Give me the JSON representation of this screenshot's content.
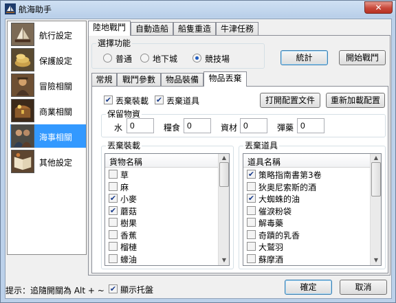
{
  "window": {
    "title": "航海助手",
    "close_label": "✕"
  },
  "sidebar": {
    "items": [
      {
        "label": "航行設定",
        "icon": "ship-icon",
        "selected": false
      },
      {
        "label": "保護設定",
        "icon": "coins-icon",
        "selected": false
      },
      {
        "label": "冒險相關",
        "icon": "explorer-icon",
        "selected": false
      },
      {
        "label": "商業相關",
        "icon": "treasure-chest-icon",
        "selected": false
      },
      {
        "label": "海事相關",
        "icon": "sailors-icon",
        "selected": true
      },
      {
        "label": "其他設定",
        "icon": "book-icon",
        "selected": false
      }
    ]
  },
  "main_tabs": [
    {
      "label": "陸地戰鬥",
      "active": true
    },
    {
      "label": "自動造船",
      "active": false
    },
    {
      "label": "船隻重造",
      "active": false
    },
    {
      "label": "牛津任務",
      "active": false
    }
  ],
  "function_group": {
    "title": "選擇功能",
    "options": [
      {
        "label": "普通",
        "selected": false
      },
      {
        "label": "地下城",
        "selected": false
      },
      {
        "label": "競技場",
        "selected": true
      }
    ]
  },
  "buttons": {
    "stats": "統計",
    "start_battle": "開始戰鬥",
    "open_config": "打開配置文件",
    "reload_config": "重新加載配置",
    "ok": "確定",
    "cancel": "取消"
  },
  "sub_tabs": [
    {
      "label": "常規",
      "active": false
    },
    {
      "label": "戰鬥參數",
      "active": false
    },
    {
      "label": "物品裝備",
      "active": false
    },
    {
      "label": "物品丟棄",
      "active": true
    }
  ],
  "discard": {
    "discard_equipment": {
      "label": "丟棄裝載",
      "checked": true
    },
    "discard_items": {
      "label": "丟棄道具",
      "checked": true
    }
  },
  "reserve": {
    "title": "保留物資",
    "fields": [
      {
        "label": "水",
        "value": "0"
      },
      {
        "label": "糧食",
        "value": "0"
      },
      {
        "label": "資材",
        "value": "0"
      },
      {
        "label": "彈藥",
        "value": "0"
      }
    ]
  },
  "equip_list": {
    "title": "丟棄裝載",
    "header": "貨物名稱",
    "rows": [
      {
        "label": "草",
        "checked": false
      },
      {
        "label": "麻",
        "checked": false
      },
      {
        "label": "小麥",
        "checked": true
      },
      {
        "label": "蘑菇",
        "checked": true
      },
      {
        "label": "樹果",
        "checked": false
      },
      {
        "label": "香蕉",
        "checked": false
      },
      {
        "label": "榴槤",
        "checked": false
      },
      {
        "label": "蠔油",
        "checked": false
      }
    ]
  },
  "item_list": {
    "title": "丟棄道具",
    "header": "道具名稱",
    "rows": [
      {
        "label": "策略指南書第3卷",
        "checked": true
      },
      {
        "label": "狄奧尼索斯的酒",
        "checked": false
      },
      {
        "label": "大蜘蛛的油",
        "checked": true
      },
      {
        "label": "催淚粉袋",
        "checked": false
      },
      {
        "label": "解毒藥",
        "checked": false
      },
      {
        "label": "奇蹟的乳香",
        "checked": false
      },
      {
        "label": "大鷲羽",
        "checked": false
      },
      {
        "label": "蘇摩酒",
        "checked": false
      }
    ]
  },
  "footer": {
    "hint": "提示：追隨開關為 Alt + ~",
    "tray_label": "顯示托盤",
    "tray_checked": true
  }
}
